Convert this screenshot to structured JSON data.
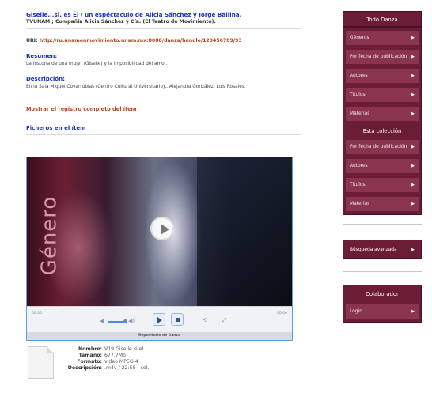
{
  "item": {
    "title": "Giselle...si, es Él / un espéctaculo de Alicia Sánchez y Jorge Ballina.",
    "subtitle": "TVUNAM ; Compañía Alicia Sánchez y Cía. (El Teatro de Movimiento).",
    "uri_label": "URI:",
    "uri_value": "http://ru.unamenmovimiento.unam.mx:8080/danza/handle/123456789/93",
    "resumen_heading": "Resumen:",
    "resumen_text": "La historia de una mujer (Giselle) y la imposibilidad del amor.",
    "descripcion_heading": "Descripción:",
    "descripcion_text": "En la Sala Miguel Covarrubias (Centro Cultural Universitario).. Alejandra González, Luis Rosales.",
    "full_record_link": "Mostrar el registro completo del ítem",
    "files_heading": "Ficheros en el ítem"
  },
  "player": {
    "thumbnail_word": "Género",
    "time_left": "00:00",
    "time_right": "00:00",
    "caption": "Repositorio de Danza",
    "progress": 0
  },
  "file": {
    "nombre_label": "Nombre:",
    "nombre_value": "V19 Giselle si el ...",
    "tamano_label": "Tamaño:",
    "tamano_value": "677.7Mb",
    "formato_label": "Formato:",
    "formato_value": "video MPEG-4",
    "descripcion_label": "Descripción:",
    "descripcion_value": ".m4v / 22:58 ; col."
  },
  "sidebar": {
    "header": "Todo Danza",
    "top_items": [
      {
        "label": "Géneros"
      },
      {
        "label": "Por fecha de publicación"
      },
      {
        "label": "Autores"
      },
      {
        "label": "Títulos"
      },
      {
        "label": "Materias"
      }
    ],
    "collection_header": "Esta colección",
    "collection_items": [
      {
        "label": "Por fecha de publicación"
      },
      {
        "label": "Autores"
      },
      {
        "label": "Títulos"
      },
      {
        "label": "Materias"
      }
    ],
    "advanced_search": "Búsqueda avanzada",
    "collaborator_header": "Colaborador",
    "login": "Login",
    "arrow_glyph": "▶"
  },
  "colors": {
    "sidebar_bg": "#6b1d36",
    "sidebar_item_bg": "#8a3450",
    "title_blue": "#1a36b8",
    "link_orange": "#b5461a"
  }
}
